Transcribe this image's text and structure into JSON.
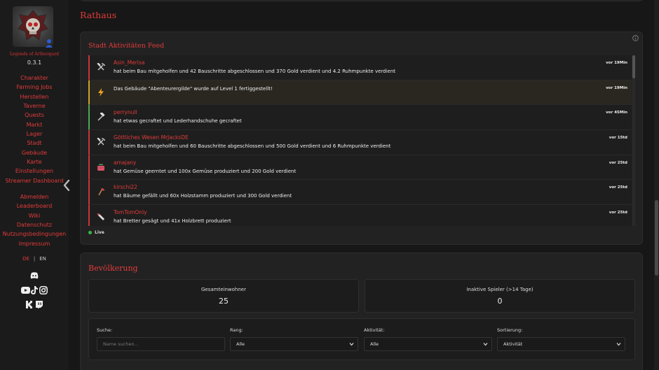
{
  "sidebar": {
    "brand": "Legends of Artheogard",
    "version": "0.3.1",
    "nav_main": [
      {
        "label": "Charakter"
      },
      {
        "label": "Farming Jobs"
      },
      {
        "label": "Herstellen"
      },
      {
        "label": "Taverne"
      },
      {
        "label": "Quests"
      },
      {
        "label": "Markt"
      },
      {
        "label": "Lager"
      },
      {
        "label": "Stadt"
      },
      {
        "label": "Gebäude"
      },
      {
        "label": "Karte"
      },
      {
        "label": "Einstellungen"
      },
      {
        "label": "Streamer Dashboard"
      }
    ],
    "nav_secondary": [
      {
        "label": "Abmelden"
      },
      {
        "label": "Leaderboard"
      },
      {
        "label": "Wiki"
      },
      {
        "label": "Datenschutz"
      },
      {
        "label": "Nutzungsbedingungen"
      },
      {
        "label": "Impressum"
      }
    ],
    "lang_de": "DE",
    "lang_sep": "|",
    "lang_en": "EN",
    "social_icons": [
      "discord-icon",
      "youtube-icon",
      "tiktok-icon",
      "instagram-icon",
      "kick-icon",
      "twitch-icon"
    ]
  },
  "page": {
    "title": "Rathaus"
  },
  "feed": {
    "title": "Stadt Aktivitäten Feed",
    "live_label": "Live",
    "items": [
      {
        "kind": "build",
        "icon": "hammer-pick-icon",
        "user": "Asin_Merisa",
        "text": "hat beim Bau mitgeholfen und 42 Bauschritte abgeschlossen und 370 Gold verdient und 4.2 Ruhmpunkte verdient",
        "time": "vor 19Min"
      },
      {
        "kind": "system",
        "icon": "lightning-icon",
        "user": "",
        "text": "Das Gebäude \"Abenteurergilde\" wurde auf Level 1 fertiggestellt!",
        "time": "vor 19Min"
      },
      {
        "kind": "craft",
        "icon": "hammer-icon",
        "user": "perrynull",
        "text": "hat etwas gecraftet und Lederhandschuhe gecraftet",
        "time": "vor 45Min"
      },
      {
        "kind": "build",
        "icon": "hammer-pick-icon",
        "user": "Göttliches Wesen MrJacksDE",
        "text": "hat beim Bau mitgeholfen und 60 Bauschritte abgeschlossen und 500 Gold verdient und 6 Ruhmpunkte verdient",
        "time": "vor 15td"
      },
      {
        "kind": "build",
        "icon": "basket-icon",
        "user": "amajany",
        "text": "hat Gemüse geerntet und 100x Gemüse produziert und 200 Gold verdient",
        "time": "vor 25td"
      },
      {
        "kind": "build",
        "icon": "axe-icon",
        "user": "kirschi22",
        "text": "hat Bäume gefällt und 60x Holzstamm produziert und 300 Gold verdient",
        "time": "vor 25td"
      },
      {
        "kind": "build",
        "icon": "saw-icon",
        "user": "TomTomOnly",
        "text": "hat Bretter gesägt und 41x Holzbrett produziert",
        "time": "vor 25td"
      }
    ]
  },
  "population": {
    "title": "Bevölkerung",
    "total_label": "Gesamteinwohner",
    "total_value": "25",
    "inactive_label": "Inaktive Spieler (>14 Tage)",
    "inactive_value": "0",
    "filters": {
      "search_label": "Suche:",
      "search_placeholder": "Name suchen...",
      "rank_label": "Rang:",
      "rank_value": "Alle",
      "activity_label": "Aktivität:",
      "activity_value": "Alle",
      "sort_label": "Sortierung:",
      "sort_value": "Aktivität"
    }
  },
  "colors": {
    "accent": "#e23b3b",
    "background": "#171717",
    "card": "#222222",
    "live": "#3ab54a",
    "system_border": "#caa52a",
    "craft_border": "#4caa55"
  }
}
